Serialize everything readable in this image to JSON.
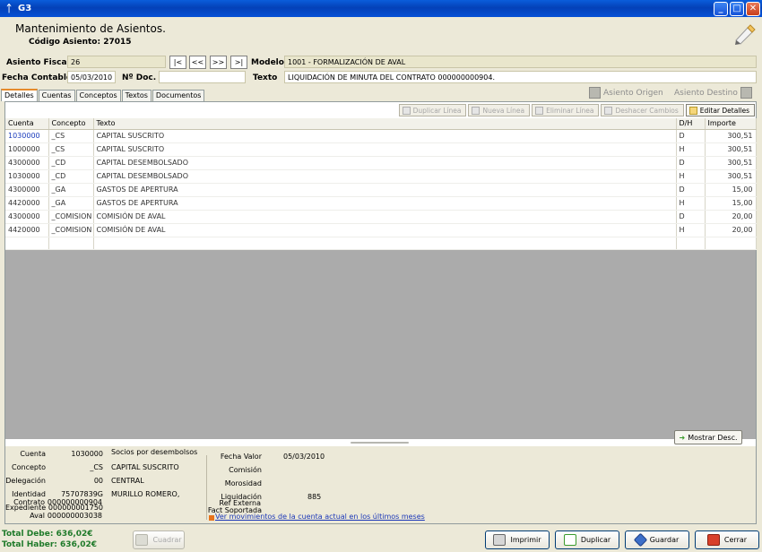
{
  "window": {
    "app_title": "G3",
    "minimize": "_",
    "maximize": "□",
    "close": "✕"
  },
  "header": {
    "title": "Mantenimiento de Asientos.",
    "subtitle": "Código Asiento: 27015"
  },
  "form": {
    "asiento_fiscal_label": "Asiento Fiscal",
    "asiento_fiscal_value": "26",
    "nav": [
      "|<",
      "<<",
      ">>",
      ">|"
    ],
    "modelo_label": "Modelo",
    "modelo_value": "1001 - FORMALIZACIÓN DE AVAL",
    "fecha_contable_label": "Fecha Contable",
    "fecha_contable_value": "05/03/2010",
    "ndoc_label": "Nº Doc.",
    "ndoc_value": "",
    "texto_label": "Texto",
    "texto_value": "LIQUIDACIÓN DE MINUTA DEL CONTRATO 000000000904."
  },
  "tabs": [
    "Detalles",
    "Cuentas",
    "Conceptos",
    "Textos",
    "Documentos"
  ],
  "actions": {
    "asiento_origen": "Asiento Origen",
    "asiento_destino": "Asiento Destino"
  },
  "toolbar": {
    "duplicar": "Duplicar Línea",
    "nueva": "Nueva Línea",
    "eliminar": "Eliminar Línea",
    "deshacer": "Deshacer Cambios",
    "editar": "Editar Detalles"
  },
  "grid": {
    "columns": [
      "Cuenta",
      "Concepto",
      "Texto",
      "D/H",
      "Importe"
    ],
    "rows": [
      [
        "1030000",
        "_CS",
        "CAPITAL SUSCRITO",
        "D",
        "300,51"
      ],
      [
        "1000000",
        "_CS",
        "CAPITAL SUSCRITO",
        "H",
        "300,51"
      ],
      [
        "4300000",
        "_CD",
        "CAPITAL DESEMBOLSADO",
        "D",
        "300,51"
      ],
      [
        "1030000",
        "_CD",
        "CAPITAL DESEMBOLSADO",
        "H",
        "300,51"
      ],
      [
        "4300000",
        "_GA",
        "GASTOS DE APERTURA",
        "D",
        "15,00"
      ],
      [
        "4420000",
        "_GA",
        "GASTOS DE APERTURA",
        "H",
        "15,00"
      ],
      [
        "4300000",
        "_COMISION",
        "COMISIÓN DE AVAL",
        "D",
        "20,00"
      ],
      [
        "4420000",
        "_COMISION",
        "COMISIÓN DE AVAL",
        "H",
        "20,00"
      ]
    ]
  },
  "detail": {
    "cuenta_label": "Cuenta",
    "cuenta_value": "1030000",
    "cuenta_desc": "Socios por desembolsos",
    "concepto_label": "Concepto",
    "concepto_value": "_CS",
    "concepto_desc": "CAPITAL SUSCRITO",
    "delegacion_label": "Delegación",
    "delegacion_value": "00",
    "delegacion_desc": "CENTRAL",
    "identidad_label": "Identidad",
    "identidad_value": "75707839G",
    "identidad_desc": "MURILLO ROMERO,",
    "expediente_label": "Expediente",
    "expediente_value": "000000001750",
    "contrato_label": "Contrato",
    "contrato_value": "000000000904",
    "aval_label": "Aval",
    "aval_value": "000000003038",
    "fecha_valor_label": "Fecha Valor",
    "fecha_valor_value": "05/03/2010",
    "comision_label": "Comisión",
    "morosidad_label": "Morosidad",
    "liquidacion_label": "Liquidación",
    "liquidacion_value": "885",
    "fact_soportada_label": "Fact Soportada",
    "ref_externa_label": "Ref Externa",
    "link": "Ver movimientos de la cuenta actual en los últimos meses",
    "mostrar": "Mostrar Desc."
  },
  "footer": {
    "total_debe": "Total Debe: 636,02€",
    "total_haber": "Total Haber: 636,02€",
    "cuadrar": "Cuadrar",
    "imprimir": "Imprimir",
    "duplicar": "Duplicar",
    "guardar": "Guardar",
    "cerrar": "Cerrar"
  }
}
